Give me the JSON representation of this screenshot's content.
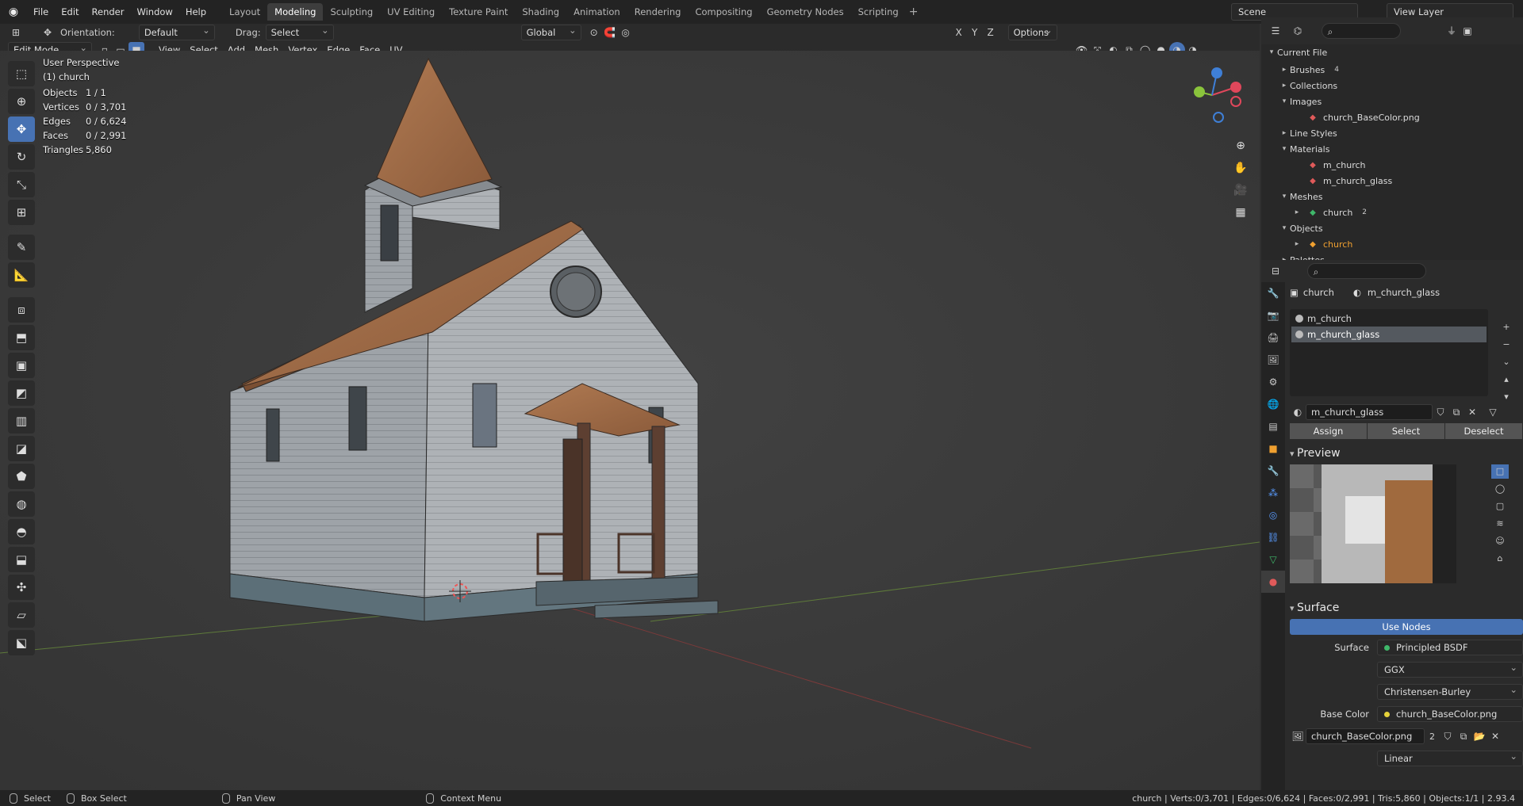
{
  "topbar": {
    "menus": [
      "File",
      "Edit",
      "Render",
      "Window",
      "Help"
    ],
    "workspaces": [
      "Layout",
      "Modeling",
      "Sculpting",
      "UV Editing",
      "Texture Paint",
      "Shading",
      "Animation",
      "Rendering",
      "Compositing",
      "Geometry Nodes",
      "Scripting"
    ],
    "active_workspace": "Modeling",
    "scene": "Scene",
    "view_layer": "View Layer"
  },
  "tool_header": {
    "orientation_label": "Orientation:",
    "orientation_value": "Default",
    "drag_label": "Drag:",
    "drag_value": "Select Box",
    "transform_orientation": "Global",
    "options": "Options"
  },
  "viewport_header": {
    "mode": "Edit Mode",
    "menus": [
      "View",
      "Select",
      "Add",
      "Mesh",
      "Vertex",
      "Edge",
      "Face",
      "UV"
    ]
  },
  "viewport": {
    "view_name": "User Perspective",
    "object_name": "(1) church",
    "stats": [
      {
        "k": "Objects",
        "v": "1 / 1"
      },
      {
        "k": "Vertices",
        "v": "0 / 3,701"
      },
      {
        "k": "Edges",
        "v": "0 / 6,624"
      },
      {
        "k": "Faces",
        "v": "0 / 2,991"
      },
      {
        "k": "Triangles",
        "v": "5,860"
      }
    ],
    "gizmo_axes": {
      "x": "X",
      "y": "Y",
      "z": "Z"
    },
    "axis_colors": {
      "x": "#e0475b",
      "y": "#8ac43c",
      "z": "#3f7fd6"
    }
  },
  "outliner": {
    "root": "Current File",
    "rows": [
      {
        "label": "Brushes",
        "depth": 1,
        "arrow": "▸",
        "badge": "4"
      },
      {
        "label": "Collections",
        "depth": 1,
        "arrow": "▸",
        "badge": ""
      },
      {
        "label": "Images",
        "depth": 1,
        "arrow": "▾",
        "badge": ""
      },
      {
        "label": "church_BaseColor.png",
        "depth": 2,
        "arrow": "",
        "badge": ""
      },
      {
        "label": "Line Styles",
        "depth": 1,
        "arrow": "▸",
        "badge": ""
      },
      {
        "label": "Materials",
        "depth": 1,
        "arrow": "▾",
        "badge": ""
      },
      {
        "label": "m_church",
        "depth": 2,
        "arrow": "",
        "badge": ""
      },
      {
        "label": "m_church_glass",
        "depth": 2,
        "arrow": "",
        "badge": ""
      },
      {
        "label": "Meshes",
        "depth": 1,
        "arrow": "▾",
        "badge": ""
      },
      {
        "label": "church",
        "depth": 2,
        "arrow": "▸",
        "badge": "2"
      },
      {
        "label": "Objects",
        "depth": 1,
        "arrow": "▾",
        "badge": ""
      },
      {
        "label": "church",
        "depth": 2,
        "arrow": "▸",
        "badge": ""
      },
      {
        "label": "Palettes",
        "depth": 1,
        "arrow": "▸",
        "badge": ""
      }
    ]
  },
  "properties": {
    "crumb_object": "church",
    "crumb_material": "m_church_glass",
    "material_slots": [
      "m_church",
      "m_church_glass"
    ],
    "active_slot": "m_church_glass",
    "slot_material": "m_church_glass",
    "assign": "Assign",
    "select": "Select",
    "deselect": "Deselect",
    "preview_title": "Preview",
    "surface_title": "Surface",
    "use_nodes": "Use Nodes",
    "surface_key": "Surface",
    "surface_value": "Principled BSDF",
    "distribution": "GGX",
    "subsurface_method": "Christensen-Burley",
    "base_color_key": "Base Color",
    "base_color_value": "church_BaseColor.png",
    "image_name": "church_BaseColor.png",
    "image_users": "2",
    "interpolation": "Linear"
  },
  "statusbar": {
    "select": "Select",
    "box_select": "Box Select",
    "pan_view": "Pan View",
    "context_menu": "Context Menu",
    "stats": "church | Verts:0/3,701 | Edges:0/6,624 | Faces:0/2,991 | Tris:5,860 | Objects:1/1 | 2.93.4"
  },
  "colors": {
    "accent": "#4772b3",
    "active_object": "#f0a030"
  }
}
